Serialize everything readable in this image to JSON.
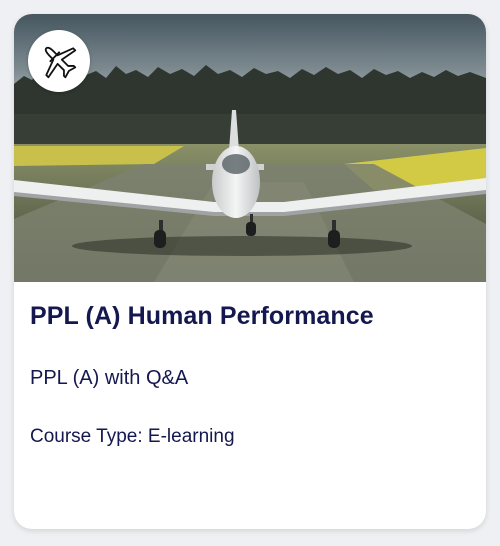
{
  "course_card": {
    "title": "PPL (A) Human Performance",
    "subtitle": "PPL (A) with Q&A",
    "course_type": "Course Type: E-learning",
    "badge_icon": "airplane-icon",
    "image": "photo of a single-engine aircraft on a grass airfield runway",
    "colors": {
      "title_text": "#14184f",
      "card_background": "#ffffff",
      "page_background": "#eef0f3"
    }
  }
}
